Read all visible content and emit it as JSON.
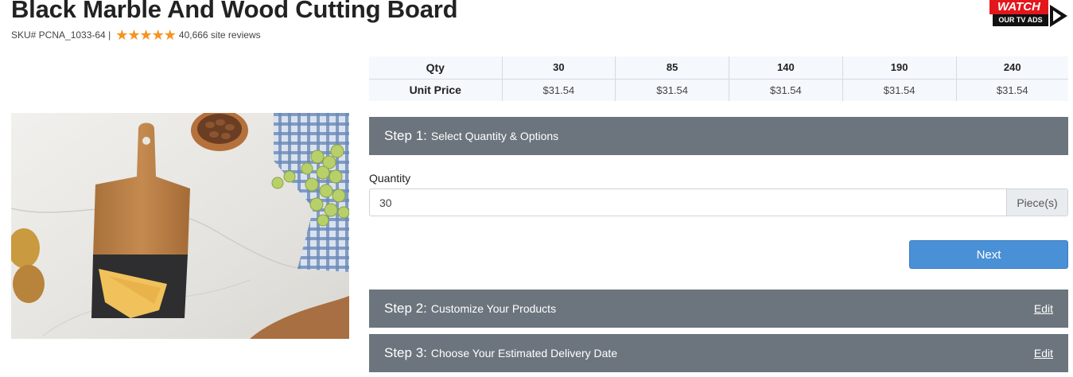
{
  "product": {
    "title": "Black Marble And Wood Cutting Board",
    "sku": "SKU# PCNA_1033-64 |",
    "rating_stars": 5,
    "reviews": "40,666 site reviews"
  },
  "promo": {
    "watch": "WATCH",
    "tv_ads": "OUR TV ADS"
  },
  "pricing": {
    "qty_header": "Qty",
    "price_header": "Unit Price",
    "quantities": [
      "30",
      "85",
      "140",
      "190",
      "240"
    ],
    "prices": [
      "$31.54",
      "$31.54",
      "$31.54",
      "$31.54",
      "$31.54"
    ]
  },
  "steps": [
    {
      "num": "Step 1:",
      "label": "Select Quantity & Options",
      "edit": ""
    },
    {
      "num": "Step 2:",
      "label": "Customize Your Products",
      "edit": "Edit"
    },
    {
      "num": "Step 3:",
      "label": "Choose Your Estimated Delivery Date",
      "edit": "Edit"
    }
  ],
  "quantity_form": {
    "label": "Quantity",
    "value": "30",
    "unit": "Piece(s)",
    "next_label": "Next"
  },
  "colors": {
    "step_bg": "#6c757d",
    "button_blue": "#4a90d6",
    "star_orange": "#f6921e",
    "watch_red": "#e3161c"
  }
}
